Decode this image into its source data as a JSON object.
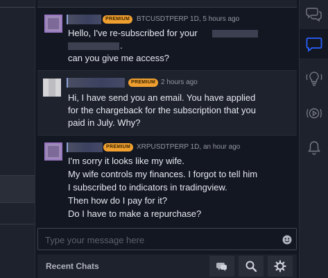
{
  "messages": [
    {
      "badge": "PREMIUM",
      "meta": "BTCUSDTPERP 1D, 5 hours ago",
      "line1": "Hello, I've re-subscribed for your",
      "line2": ".",
      "line3": "can you give me access?"
    },
    {
      "badge": "PREMIUM",
      "meta": "2 hours ago",
      "lines": [
        "Hi, I have send you an email. You have applied",
        "for the chargeback for the subscription that you",
        "paid in July. Why?"
      ]
    },
    {
      "badge": "PREMIUM",
      "meta": "XRPUSDTPERP 1D,  an hour ago",
      "lines": [
        "I'm sorry it looks like my wife.",
        "My wife controls my finances. I forgot to tell him",
        "I subscribed to indicators in tradingview.",
        "Then how do I pay for it?",
        "Do I have to make a repurchase?"
      ]
    }
  ],
  "input": {
    "placeholder": "Type your message here"
  },
  "bottom_bar": {
    "recent_chats": "Recent Chats"
  },
  "icons": {
    "rail": [
      "chats-icon",
      "chat-active-icon",
      "lightbulb-icon",
      "play-icon",
      "bell-icon"
    ],
    "bottom": [
      "new-chat-icon",
      "search-icon",
      "gear-icon"
    ],
    "input": "emoji-icon"
  },
  "colors": {
    "badge": "#f0a030",
    "rail_active": "#2962ff",
    "background": "#131722"
  }
}
